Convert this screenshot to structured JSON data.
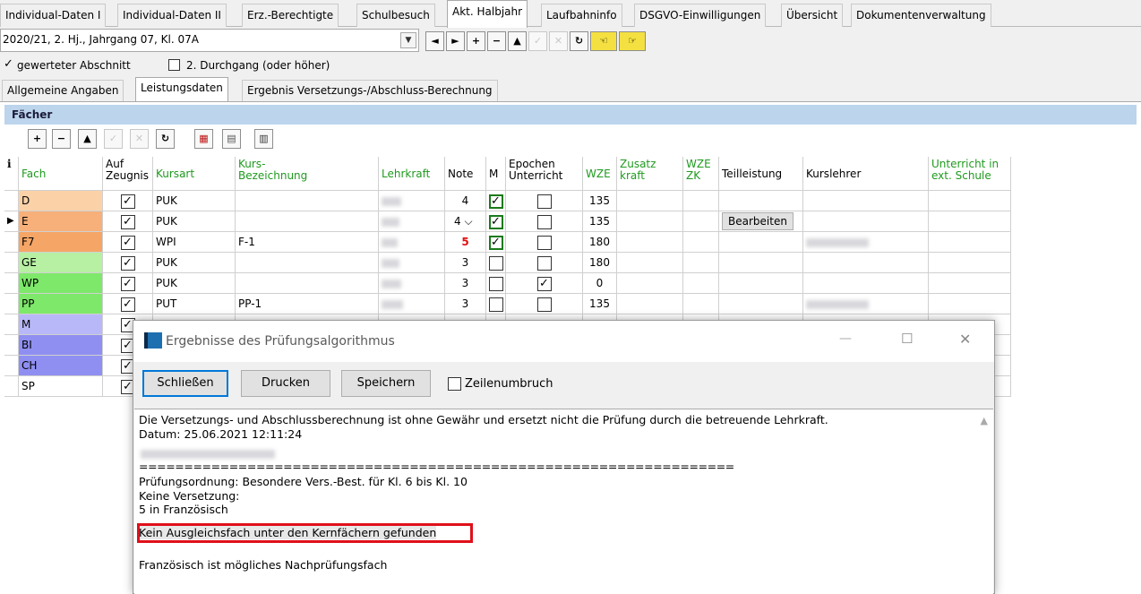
{
  "top_tabs": [
    "Individual-Daten I",
    "Individual-Daten II",
    "Erz.-Berechtigte",
    "Schulbesuch",
    "Akt. Halbjahr",
    "Laufbahninfo",
    "DSGVO-Einwilligungen",
    "Übersicht",
    "Dokumentenverwaltung"
  ],
  "active_top_tab": "Akt. Halbjahr",
  "period_select": "2020/21, 2. Hj., Jahrgang 07, Kl. 07A",
  "nav_glyphs": {
    "first": "◄",
    "next": "►",
    "add": "+",
    "remove": "−",
    "up": "▲",
    "ok": "✓",
    "cancel": "✕",
    "refresh": "↻",
    "prev_hand": "☜",
    "next_hand": "☞"
  },
  "options": {
    "gewerteter_label": "gewerteter Abschnitt",
    "gewerteter_checked": true,
    "durchgang_label": "2. Durchgang (oder höher)",
    "durchgang_checked": false
  },
  "sub_tabs": [
    "Allgemeine Angaben",
    "Leistungsdaten",
    "Ergebnis Versetzungs-/Abschluss-Berechnung"
  ],
  "active_sub_tab": "Leistungsdaten",
  "section_title": "Fächer",
  "table": {
    "info_icon": "i",
    "headers": {
      "fach": "Fach",
      "auf_zeugnis": "Auf\nZeugnis",
      "kursart": "Kursart",
      "kurs_bez": "Kurs-\nBezeichnung",
      "lehrkraft": "Lehrkraft",
      "note": "Note",
      "m": "M",
      "epochen": "Epochen\nUnterricht",
      "wze": "WZE",
      "zusatzkraft": "Zusatz\nkraft",
      "wze_zk": "WZE\nZK",
      "teilleistung": "Teilleistung",
      "kurslehrer": "Kurslehrer",
      "ext": "Unterricht in\next. Schule"
    },
    "rows": [
      {
        "fach": "D",
        "color": "#fbd2a8",
        "kursart": "PUK",
        "kurs": "",
        "note": "4",
        "m": true,
        "ep": false,
        "wze": "135"
      },
      {
        "fach": "E",
        "color": "#f7b07a",
        "kursart": "PUK",
        "kurs": "",
        "note": "4",
        "m": true,
        "ep": false,
        "wze": "135",
        "current": true,
        "teil": "Bearbeiten"
      },
      {
        "fach": "F7",
        "color": "#f5a565",
        "kursart": "WPI",
        "kurs": "F-1",
        "note": "5",
        "m": true,
        "ep": false,
        "wze": "180",
        "red": true
      },
      {
        "fach": "GE",
        "color": "#b7f0a3",
        "kursart": "PUK",
        "kurs": "",
        "note": "3",
        "m": false,
        "ep": false,
        "wze": "180"
      },
      {
        "fach": "WP",
        "color": "#7ee86a",
        "kursart": "PUK",
        "kurs": "",
        "note": "3",
        "m": false,
        "ep": true,
        "wze": "0"
      },
      {
        "fach": "PP",
        "color": "#7ee86a",
        "kursart": "PUT",
        "kurs": "PP-1",
        "note": "3",
        "m": false,
        "ep": false,
        "wze": "135"
      },
      {
        "fach": "M",
        "color": "#b8b8f8",
        "kursart": "",
        "kurs": "",
        "note": "",
        "m": false,
        "ep": false,
        "wze": ""
      },
      {
        "fach": "BI",
        "color": "#8f8ff2",
        "kursart": "",
        "kurs": "",
        "note": "",
        "m": false,
        "ep": false,
        "wze": ""
      },
      {
        "fach": "CH",
        "color": "#8f8ff2",
        "kursart": "",
        "kurs": "",
        "note": "",
        "m": false,
        "ep": false,
        "wze": ""
      },
      {
        "fach": "SP",
        "color": "#ffffff",
        "kursart": "",
        "kurs": "",
        "note": "",
        "m": false,
        "ep": false,
        "wze": ""
      }
    ]
  },
  "dialog": {
    "title": "Ergebnisse des Prüfungsalgorithmus",
    "close_button": "Schließen",
    "print_button": "Drucken",
    "save_button": "Speichern",
    "wrap_label": "Zeilenumbruch",
    "window_controls": {
      "minimize": "—",
      "maximize": "☐",
      "close": "✕"
    },
    "lines": [
      "Die Versetzungs- und Abschlussberechnung ist ohne Gewähr und ersetzt nicht die Prüfung durch die betreuende Lehrkraft.",
      "Datum: 25.06.2021 12:11:24",
      "",
      "==================================================================",
      "Prüfungsordnung: Besondere Vers.-Best. für Kl. 6 bis Kl. 10",
      "Keine Versetzung:",
      "5 in Französisch",
      "Kein Ausgleichsfach unter den Kernfächern gefunden",
      "",
      "Französisch ist mögliches Nachprüfungsfach"
    ]
  }
}
